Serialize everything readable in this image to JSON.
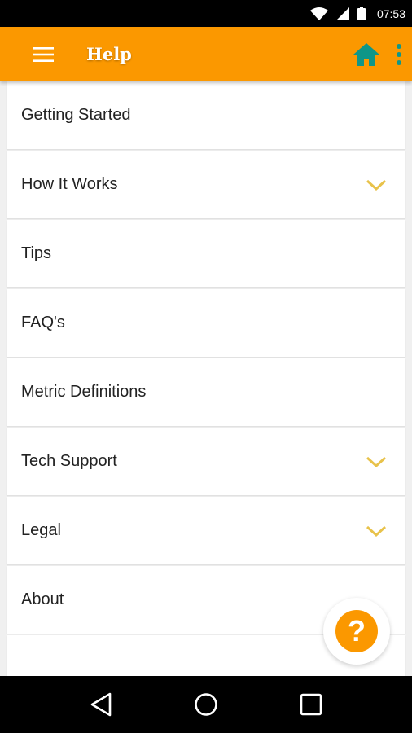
{
  "status_bar": {
    "time": "07:53",
    "icons": [
      "wifi-icon",
      "signal-icon",
      "battery-icon"
    ]
  },
  "app_bar": {
    "title": "Help",
    "background": "#fb9800",
    "home_icon_color": "#0f9688"
  },
  "menu": {
    "items": [
      {
        "label": "Getting Started",
        "expandable": false
      },
      {
        "label": "How It Works",
        "expandable": true
      },
      {
        "label": "Tips",
        "expandable": false
      },
      {
        "label": "FAQ's",
        "expandable": false
      },
      {
        "label": "Metric Definitions",
        "expandable": false
      },
      {
        "label": "Tech Support",
        "expandable": true
      },
      {
        "label": "Legal",
        "expandable": true
      },
      {
        "label": "About",
        "expandable": false
      }
    ],
    "chevron_color": "#e8c24a"
  },
  "fab": {
    "symbol": "?",
    "color": "#fb9800"
  },
  "nav_bar": {
    "icons": [
      "back-icon",
      "home-circle-icon",
      "recents-icon"
    ]
  }
}
